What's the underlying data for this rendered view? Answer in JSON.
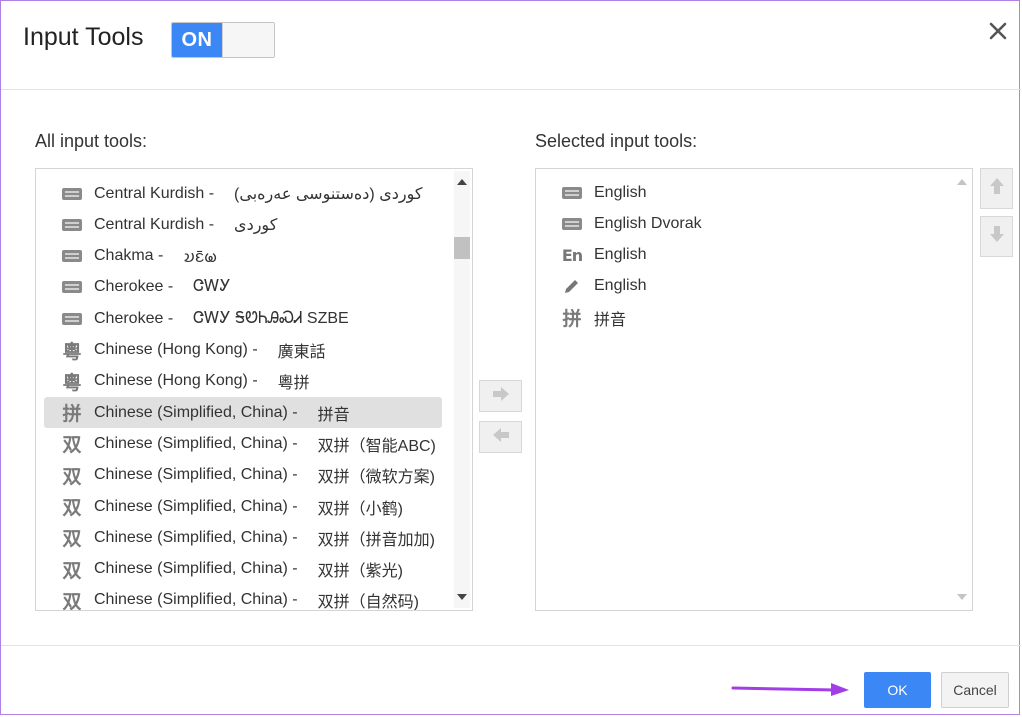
{
  "dialog": {
    "title": "Input Tools",
    "toggle_label": "ON"
  },
  "left_panel": {
    "label": "All input tools:",
    "items": [
      {
        "icon": "keyboard-icon",
        "name": "Central Kurdish -",
        "native": "(کوردی (دەستنوسی عەرەبی"
      },
      {
        "icon": "keyboard-icon",
        "name": "Central Kurdish -",
        "native": "کوردی"
      },
      {
        "icon": "keyboard-icon",
        "name": "Chakma -",
        "native": "𑄌𑄋𑄴𑄟"
      },
      {
        "icon": "keyboard-icon",
        "name": "Cherokee -",
        "native": "ᏣᎳᎩ"
      },
      {
        "icon": "keyboard-icon",
        "name": "Cherokee -",
        "native": "ᏣᎳᎩ ᎦᏬᏂᎯᏍᏗ SZBE"
      },
      {
        "icon": "yue-icon",
        "icon_glyph": "粵",
        "name": "Chinese (Hong Kong) -",
        "native": "廣東話"
      },
      {
        "icon": "yue-icon",
        "icon_glyph": "粵",
        "name": "Chinese (Hong Kong) -",
        "native": "粵拼"
      },
      {
        "icon": "pinyin-icon",
        "icon_glyph": "拼",
        "name": "Chinese (Simplified, China) -",
        "native": "拼音",
        "selected": true
      },
      {
        "icon": "shuangpin-icon",
        "icon_glyph": "双",
        "name": "Chinese (Simplified, China) -",
        "native": "双拼（智能ABC)"
      },
      {
        "icon": "shuangpin-icon",
        "icon_glyph": "双",
        "name": "Chinese (Simplified, China) -",
        "native": "双拼（微软方案)"
      },
      {
        "icon": "shuangpin-icon",
        "icon_glyph": "双",
        "name": "Chinese (Simplified, China) -",
        "native": "双拼（小鹤)"
      },
      {
        "icon": "shuangpin-icon",
        "icon_glyph": "双",
        "name": "Chinese (Simplified, China) -",
        "native": "双拼（拼音加加)"
      },
      {
        "icon": "shuangpin-icon",
        "icon_glyph": "双",
        "name": "Chinese (Simplified, China) -",
        "native": "双拼（紫光)"
      },
      {
        "icon": "shuangpin-icon",
        "icon_glyph": "双",
        "name": "Chinese (Simplified, China) -",
        "native": "双拼（自然码)"
      }
    ]
  },
  "right_panel": {
    "label": "Selected input tools:",
    "items": [
      {
        "icon": "keyboard-icon",
        "name": "English"
      },
      {
        "icon": "keyboard-icon",
        "name": "English Dvorak"
      },
      {
        "icon": "transliteration-icon",
        "icon_glyph": "En",
        "name": "English"
      },
      {
        "icon": "pencil-icon",
        "name": "English"
      },
      {
        "icon": "pinyin-icon",
        "icon_glyph": "拼",
        "name": "拼音"
      }
    ]
  },
  "footer": {
    "ok_label": "OK",
    "cancel_label": "Cancel"
  },
  "colors": {
    "accent": "#3b87f5",
    "annotation_arrow": "#a23ee8"
  }
}
